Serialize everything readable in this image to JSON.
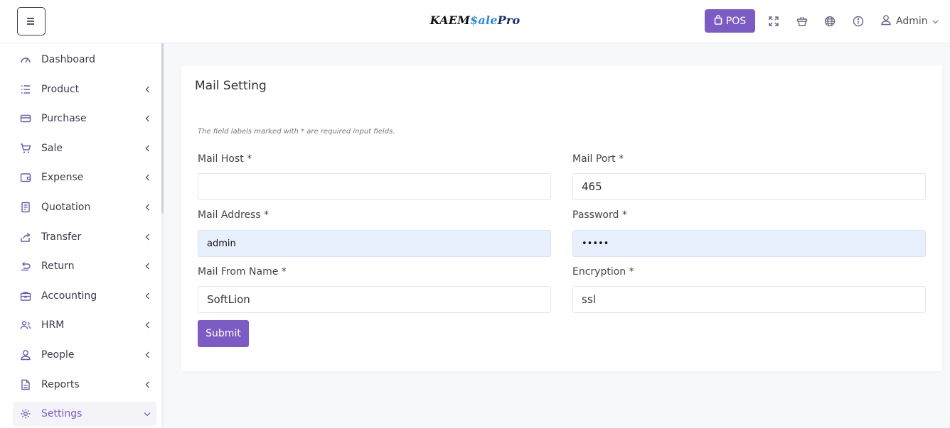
{
  "header": {
    "logo_part1": "KAEM",
    "logo_part2": "$ale",
    "logo_part3": "Pro",
    "pos_label": "POS",
    "user_label": "Admin"
  },
  "sidebar": {
    "items": [
      {
        "label": "Dashboard",
        "icon": "dashboard-icon",
        "has_chevron": false
      },
      {
        "label": "Product",
        "icon": "list-icon",
        "has_chevron": true
      },
      {
        "label": "Purchase",
        "icon": "card-icon",
        "has_chevron": true
      },
      {
        "label": "Sale",
        "icon": "cart-icon",
        "has_chevron": true
      },
      {
        "label": "Expense",
        "icon": "wallet-icon",
        "has_chevron": true
      },
      {
        "label": "Quotation",
        "icon": "document-icon",
        "has_chevron": true
      },
      {
        "label": "Transfer",
        "icon": "share-icon",
        "has_chevron": true
      },
      {
        "label": "Return",
        "icon": "return-icon",
        "has_chevron": true
      },
      {
        "label": "Accounting",
        "icon": "briefcase-icon",
        "has_chevron": true
      },
      {
        "label": "HRM",
        "icon": "users-icon",
        "has_chevron": true
      },
      {
        "label": "People",
        "icon": "user-icon",
        "has_chevron": true
      },
      {
        "label": "Reports",
        "icon": "report-icon",
        "has_chevron": true
      },
      {
        "label": "Settings",
        "icon": "gear-icon",
        "has_chevron": true,
        "active": true
      }
    ]
  },
  "main": {
    "title": "Mail Setting",
    "note": "The field labels marked with * are required input fields.",
    "fields": {
      "mail_host": {
        "label": "Mail Host *",
        "value": ""
      },
      "mail_port": {
        "label": "Mail Port *",
        "value": "465"
      },
      "mail_address": {
        "label": "Mail Address *",
        "value": "admin"
      },
      "password": {
        "label": "Password *",
        "value": "•••••"
      },
      "mail_from_name": {
        "label": "Mail From Name *",
        "value": "SoftLion"
      },
      "encryption": {
        "label": "Encryption *",
        "value": "ssl"
      }
    },
    "submit_label": "Submit"
  },
  "colors": {
    "accent": "#7c5cc4",
    "autofill_bg": "#e8f0fe",
    "page_bg": "#f7f8fa"
  }
}
